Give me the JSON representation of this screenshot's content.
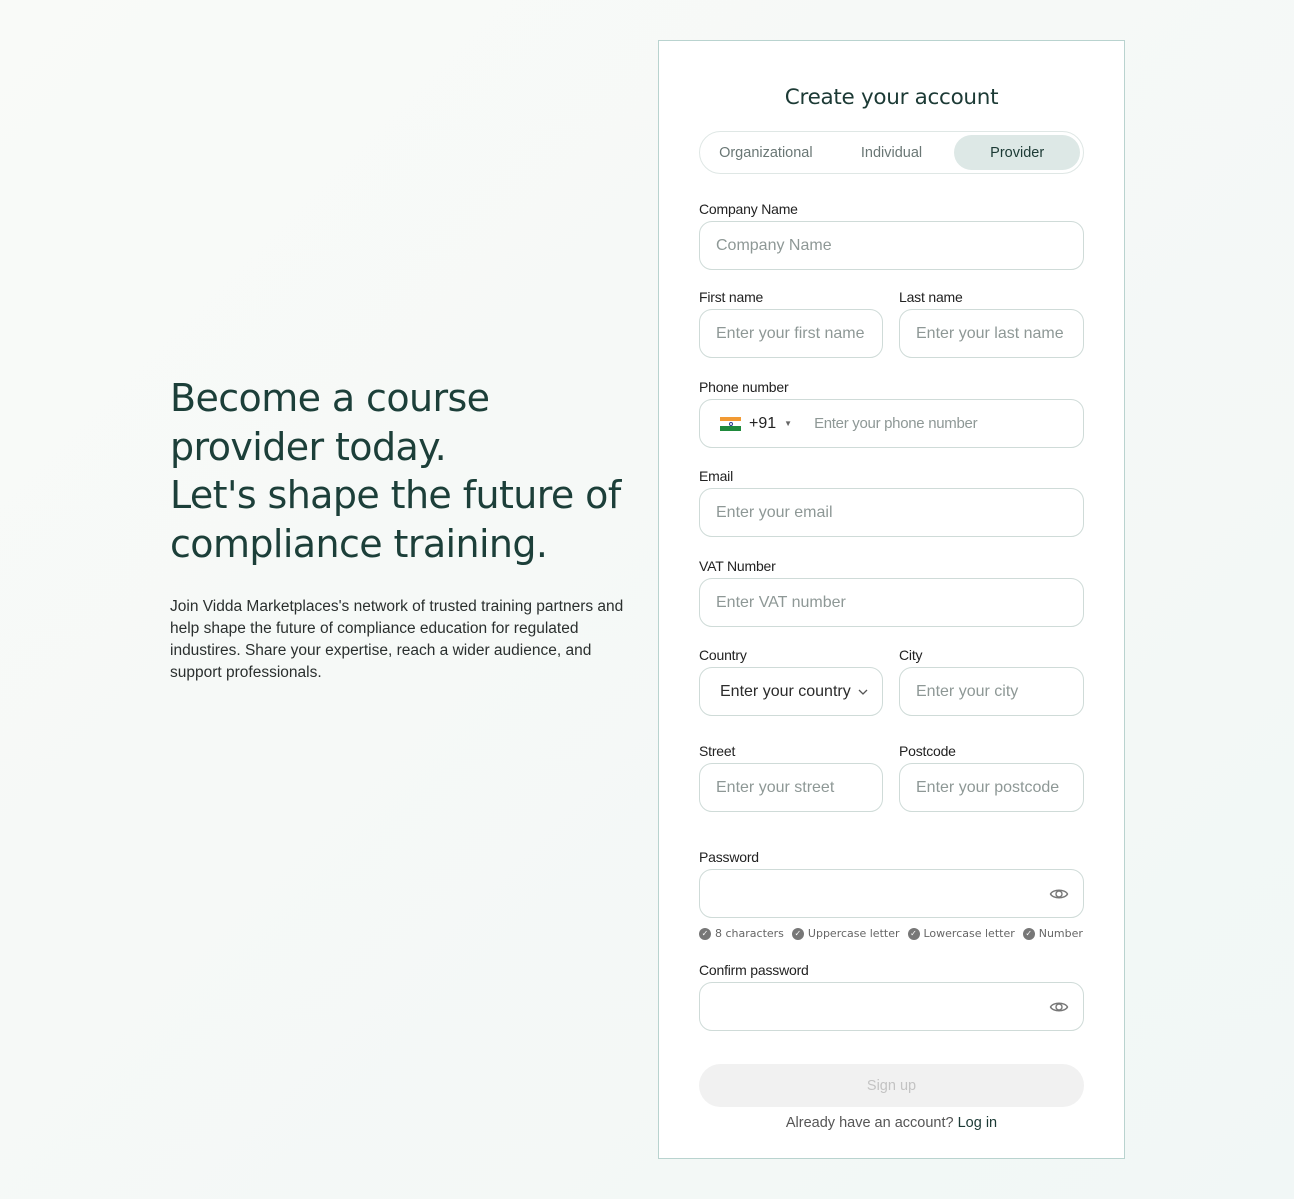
{
  "hero": {
    "line1": "Become a course",
    "line2": "provider today.",
    "line3": "Let's shape the future of",
    "line4": "compliance training.",
    "description": "Join Vidda Marketplaces's network of trusted training partners and help shape the future of compliance education for regulated industires. Share your expertise, reach a wider audience, and support professionals."
  },
  "form": {
    "title": "Create your account",
    "tabs": [
      "Organizational",
      "Individual",
      "Provider"
    ],
    "active_tab": "Provider",
    "company": {
      "label": "Company Name",
      "placeholder": "Company Name"
    },
    "first_name": {
      "label": "First name",
      "placeholder": "Enter your first name"
    },
    "last_name": {
      "label": "Last name",
      "placeholder": "Enter your last name"
    },
    "phone": {
      "label": "Phone number",
      "code": "+91",
      "placeholder": "Enter your phone number",
      "flag_icon": "india-flag-icon"
    },
    "email": {
      "label": "Email",
      "placeholder": "Enter your email"
    },
    "vat": {
      "label": "VAT Number",
      "placeholder": "Enter VAT number"
    },
    "country": {
      "label": "Country",
      "value": "Enter your country"
    },
    "city": {
      "label": "City",
      "placeholder": "Enter your city"
    },
    "street": {
      "label": "Street",
      "placeholder": "Enter your street"
    },
    "postcode": {
      "label": "Postcode",
      "placeholder": "Enter your postcode"
    },
    "password": {
      "label": "Password"
    },
    "password_rules": [
      "8 characters",
      "Uppercase letter",
      "Lowercase letter",
      "Number"
    ],
    "confirm_password": {
      "label": "Confirm password"
    },
    "signup_label": "Sign up",
    "login_prompt": "Already have an account?",
    "login_link": "Log in"
  },
  "colors": {
    "accent": "#1c3f39",
    "tab_active_bg": "#dde8e6",
    "card_border": "#b9d3cf"
  }
}
